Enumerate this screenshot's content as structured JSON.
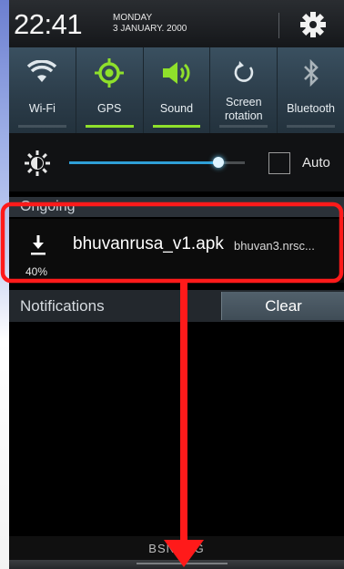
{
  "colors": {
    "accent_on": "#8fe02b",
    "annotation": "#ff1a1a",
    "slider": "#2f9fd6"
  },
  "header": {
    "time": "22:41",
    "day": "MONDAY",
    "date": "3 JANUARY. 2000",
    "settings_icon": "gear-icon"
  },
  "quick_toggles": [
    {
      "label": "Wi-Fi",
      "icon": "wifi-icon",
      "on": false
    },
    {
      "label": "GPS",
      "icon": "gps-icon",
      "on": true
    },
    {
      "label": "Sound",
      "icon": "speaker-icon",
      "on": true
    },
    {
      "label_line1": "Screen",
      "label_line2": "rotation",
      "icon": "rotation-icon",
      "on": false
    },
    {
      "label": "Bluetooth",
      "icon": "bluetooth-icon",
      "on": false
    }
  ],
  "brightness": {
    "level": 0.85,
    "auto_label": "Auto",
    "auto_checked": false
  },
  "ongoing": {
    "header": "Ongoing",
    "item": {
      "title": "bhuvanrusa_v1.apk",
      "subtitle": "bhuvan3.nrsc...",
      "progress": "40%"
    }
  },
  "notifications": {
    "title": "Notifications",
    "clear_label": "Clear"
  },
  "carrier": {
    "text": "BSNL 3G"
  }
}
